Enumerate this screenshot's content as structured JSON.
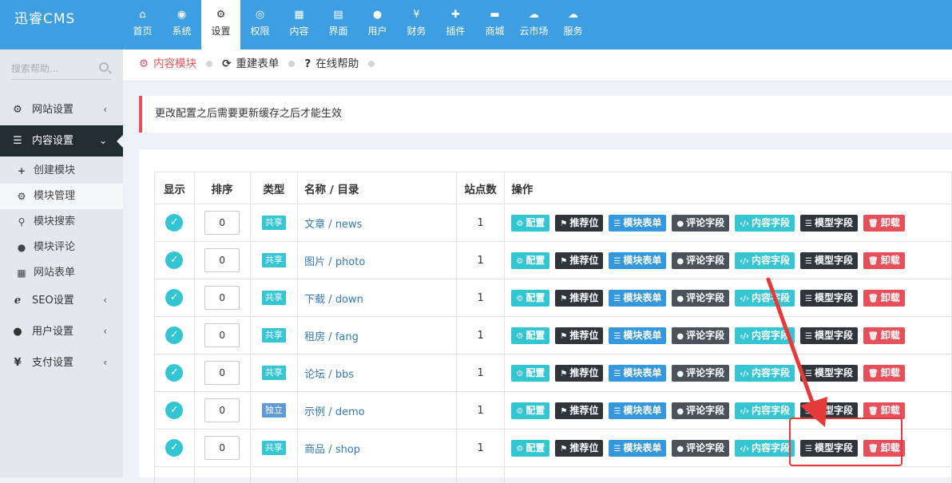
{
  "app": {
    "logo": "迅睿CMS"
  },
  "topnav": [
    {
      "label": "首页",
      "icon": "home-icon",
      "glyph": "⌂"
    },
    {
      "label": "系统",
      "icon": "globe-icon",
      "glyph": "◉"
    },
    {
      "label": "设置",
      "icon": "cogs-icon",
      "glyph": "⚙",
      "active": true
    },
    {
      "label": "权限",
      "icon": "user-circle-icon",
      "glyph": "◎"
    },
    {
      "label": "内容",
      "icon": "grid-icon",
      "glyph": "▦"
    },
    {
      "label": "界面",
      "icon": "html5-icon",
      "glyph": "▤"
    },
    {
      "label": "用户",
      "icon": "user-icon",
      "glyph": "●"
    },
    {
      "label": "财务",
      "icon": "yen-icon",
      "glyph": "¥"
    },
    {
      "label": "插件",
      "icon": "puzzle-icon",
      "glyph": "✚"
    },
    {
      "label": "商城",
      "icon": "cart-icon",
      "glyph": "▬"
    },
    {
      "label": "云市场",
      "icon": "cloud-icon",
      "glyph": "☁"
    },
    {
      "label": "服务",
      "icon": "cloud-icon",
      "glyph": "☁"
    }
  ],
  "sidebar": {
    "search_placeholder": "搜索帮助...",
    "items": [
      {
        "label": "网站设置",
        "icon": "gear-icon",
        "glyph": "⚙"
      },
      {
        "label": "内容设置",
        "icon": "list-icon",
        "glyph": "☰"
      },
      {
        "label": "SEO设置",
        "icon": "ie-icon",
        "glyph": "ℯ"
      },
      {
        "label": "用户设置",
        "icon": "user-icon",
        "glyph": "●"
      },
      {
        "label": "支付设置",
        "icon": "yen-icon",
        "glyph": "¥"
      }
    ],
    "subitems": [
      {
        "label": "创建模块",
        "icon": "plus-icon",
        "glyph": "+"
      },
      {
        "label": "模块管理",
        "icon": "cogs-icon",
        "glyph": "⚙"
      },
      {
        "label": "模块搜索",
        "icon": "search-icon",
        "glyph": "⚲"
      },
      {
        "label": "模块评论",
        "icon": "comments-icon",
        "glyph": "●"
      },
      {
        "label": "网站表单",
        "icon": "table-icon",
        "glyph": "▦"
      }
    ]
  },
  "breadcrumb": [
    {
      "label": "内容模块",
      "icon": "cogs-icon",
      "glyph": "⚙"
    },
    {
      "label": "重建表单",
      "icon": "refresh-icon",
      "glyph": "⟳"
    },
    {
      "label": "在线帮助",
      "icon": "question-circle-icon",
      "glyph": "?"
    }
  ],
  "notice": "更改配置之后需要更新缓存之后才能生效",
  "table": {
    "headers": [
      "显示",
      "排序",
      "类型",
      "名称 / 目录",
      "站点数",
      "操作"
    ],
    "actions": [
      "配置",
      "推荐位",
      "模块表单",
      "评论字段",
      "内容字段",
      "模型字段",
      "卸载"
    ],
    "rows": [
      {
        "order": "0",
        "type": "共享",
        "name": "文章 / news",
        "sites": "1"
      },
      {
        "order": "0",
        "type": "共享",
        "name": "图片 / photo",
        "sites": "1"
      },
      {
        "order": "0",
        "type": "共享",
        "name": "下载 / down",
        "sites": "1"
      },
      {
        "order": "0",
        "type": "共享",
        "name": "租房 / fang",
        "sites": "1"
      },
      {
        "order": "0",
        "type": "共享",
        "name": "论坛 / bbs",
        "sites": "1"
      },
      {
        "order": "0",
        "type": "独立",
        "name": "示例 / demo",
        "sites": "1"
      },
      {
        "order": "0",
        "type": "共享",
        "name": "商品 / shop",
        "sites": "1"
      }
    ]
  },
  "colors": {
    "topbar": "#3d9ee2",
    "sidebar_active": "#222d32",
    "accent_red": "#e7505a",
    "annotation_red": "#e53a3a"
  }
}
